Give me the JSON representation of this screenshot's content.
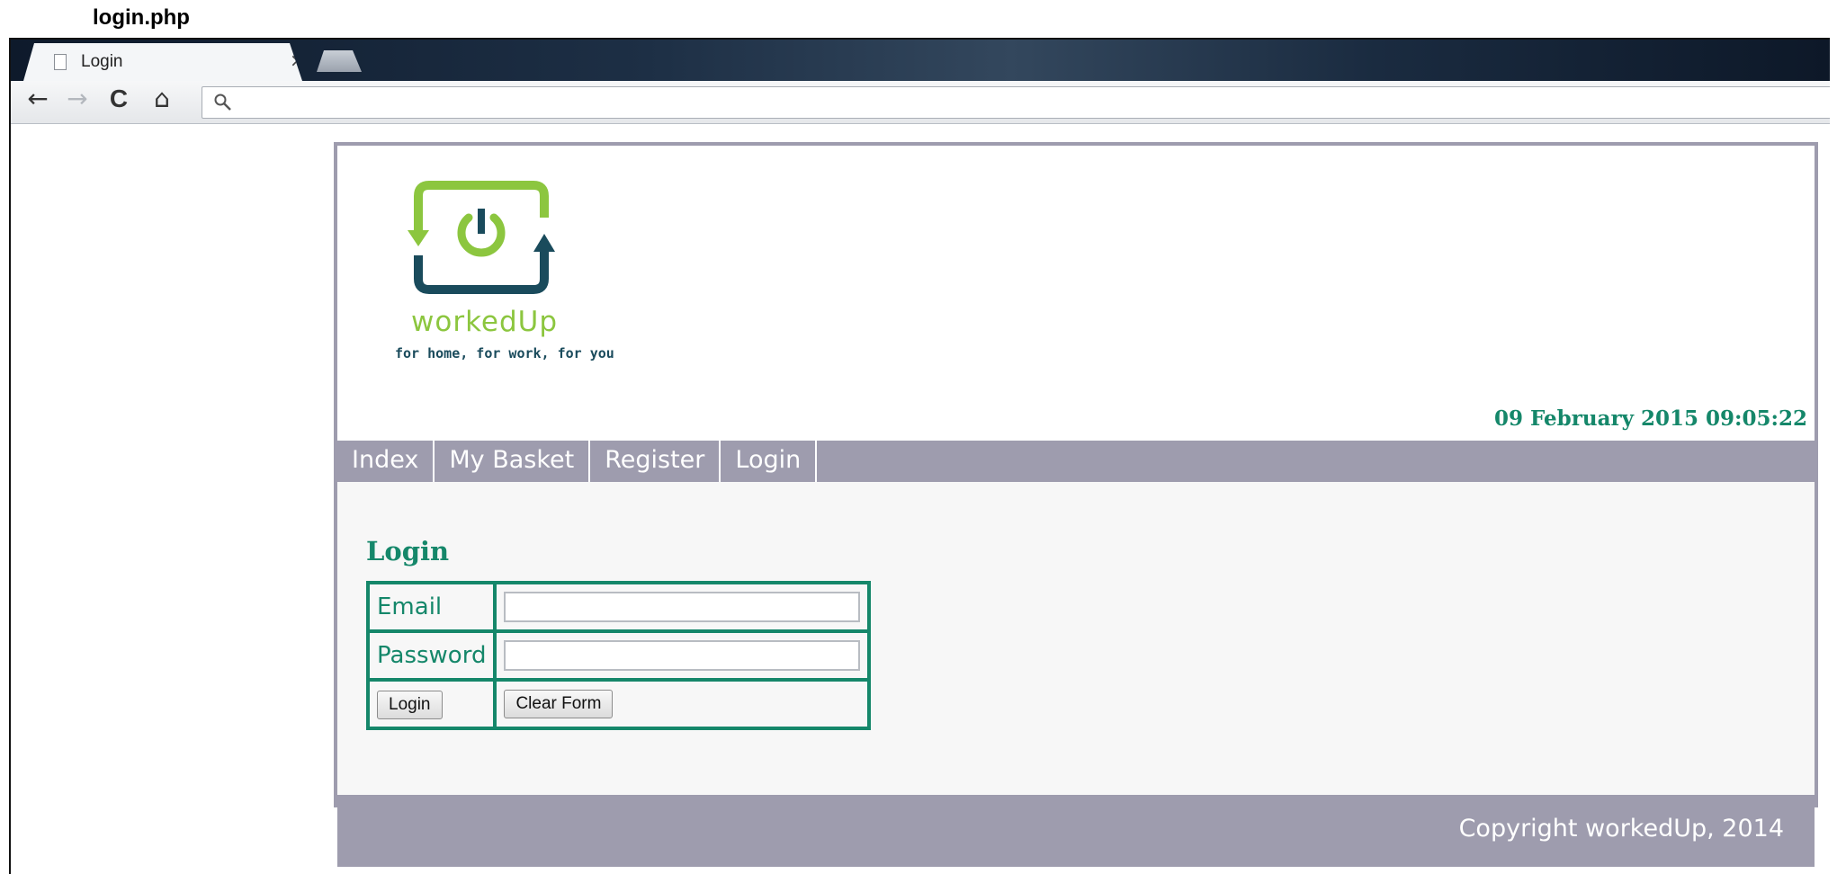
{
  "caption": "login.php",
  "browser": {
    "tab_title": "Login",
    "tab_close": "×",
    "nav": {
      "back_icon": "←",
      "forward_icon": "→",
      "reload_icon": "C",
      "home_icon": "⌂"
    },
    "omnibox_value": ""
  },
  "site": {
    "brand_name": "workedUp",
    "brand_tagline": "for home, for work, for you",
    "datetime": "09 February 2015 09:05:22",
    "nav_items": [
      "Index",
      "My Basket",
      "Register",
      "Login"
    ],
    "login": {
      "heading": "Login",
      "email_label": "Email",
      "password_label": "Password",
      "email_value": "",
      "password_value": "",
      "login_button": "Login",
      "clear_button": "Clear Form"
    },
    "footer": "Copyright workedUp, 2014"
  },
  "colors": {
    "accent_green": "#15876a",
    "logo_green": "#8cc63f",
    "logo_dark": "#1a4b5c",
    "bar_grey": "#9e9cae"
  }
}
